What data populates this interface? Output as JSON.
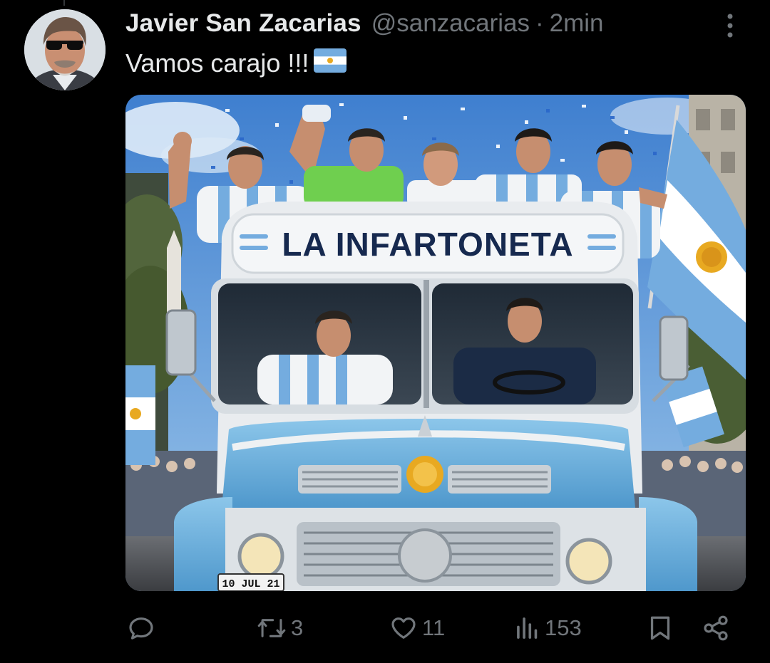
{
  "tweet": {
    "display_name": "Javier San Zacarias",
    "handle": "@sanzacarias",
    "separator": "·",
    "time": "2min",
    "text": "Vamos carajo !!!",
    "text_emoji": "argentina-flag-emoji"
  },
  "media": {
    "banner_text": "LA INFARTONETA",
    "plate_text": "10 JUL 21",
    "colors": {
      "sky": "#4d8fd6",
      "bus_blue": "#6fb3df",
      "bus_white": "#eef1f3",
      "flag_blue": "#74acdf",
      "sun": "#e8a921",
      "banner_text": "#16294f"
    }
  },
  "actions": {
    "reply": {
      "icon": "reply-icon",
      "count": ""
    },
    "repost": {
      "icon": "repost-icon",
      "count": "3"
    },
    "like": {
      "icon": "heart-icon",
      "count": "11"
    },
    "views": {
      "icon": "views-icon",
      "count": "153"
    },
    "bookmark": {
      "icon": "bookmark-icon",
      "count": ""
    },
    "share": {
      "icon": "share-icon",
      "count": ""
    }
  },
  "theme": {
    "background": "#000000",
    "text": "#e7e9ea",
    "muted": "#71767b"
  }
}
